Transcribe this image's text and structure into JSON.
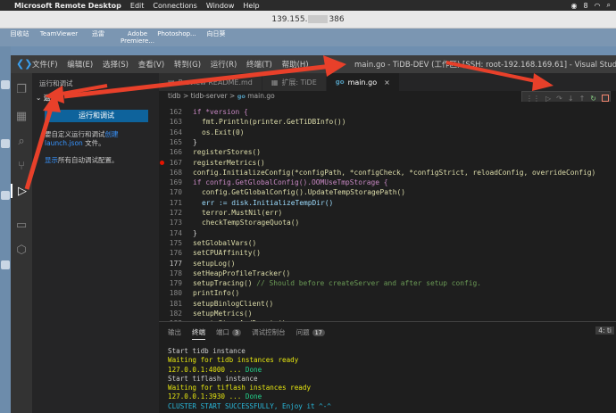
{
  "menubar": {
    "app": "Microsoft Remote Desktop",
    "items": [
      "Edit",
      "Connections",
      "Window",
      "Help"
    ],
    "right": [
      "8"
    ]
  },
  "rdp": {
    "title_left": "139.155.",
    "title_right": "386"
  },
  "desktop": {
    "icons": [
      "回收站",
      "TeamViewer",
      "迅雷",
      "Adobe Premiere...",
      "Photoshop...",
      "向日葵"
    ]
  },
  "window": {
    "menu": [
      "文件(F)",
      "编辑(E)",
      "选择(S)",
      "查看(V)",
      "转到(G)",
      "运行(R)",
      "终端(T)",
      "帮助(H)"
    ],
    "title": "main.go - TiDB-DEV (工作区) [SSH: root-192.168.169.61] - Visual Studio Code"
  },
  "sidebar": {
    "header": "运行和调试",
    "section": "运行",
    "run_button": "运行和调试",
    "p1_pre": "要自定义运行和调试",
    "p1_link": "创建 launch.json",
    "p1_post": " 文件。",
    "p2_link": "显示",
    "p2_post": "所有自动调试配置。"
  },
  "tabs": [
    {
      "label": "Preview README.md",
      "icon": ""
    },
    {
      "label": "扩展: TiDE",
      "icon": ""
    },
    {
      "label": "main.go",
      "icon": "go"
    }
  ],
  "breadcrumb": {
    "a": "tidb",
    "b": "tidb-server",
    "file": "main.go",
    "gi": "go",
    "sep": ">"
  },
  "code": [
    {
      "n": "162",
      "text": "if *version {",
      "cls": "kw",
      "indent": 0
    },
    {
      "n": "163",
      "text": "fmt.Println(printer.GetTiDBInfo())",
      "cls": "fn",
      "indent": 1
    },
    {
      "n": "164",
      "text": "os.Exit(0)",
      "cls": "fn",
      "indent": 1
    },
    {
      "n": "165",
      "text": "}",
      "cls": "plain",
      "indent": 0
    },
    {
      "n": "166",
      "text": "registerStores()",
      "cls": "fn",
      "indent": 0
    },
    {
      "n": "167",
      "text": "registerMetrics()",
      "cls": "fn",
      "indent": 0,
      "bp": true
    },
    {
      "n": "168",
      "text": "config.InitializeConfig(*configPath, *configCheck, *configStrict, reloadConfig, overrideConfig)",
      "cls": "fn",
      "indent": 0
    },
    {
      "n": "169",
      "text": "if config.GetGlobalConfig().OOMUseTmpStorage {",
      "cls": "kw",
      "indent": 0
    },
    {
      "n": "170",
      "text": "config.GetGlobalConfig().UpdateTempStoragePath()",
      "cls": "fn",
      "indent": 1
    },
    {
      "n": "171",
      "text": "err := disk.InitializeTempDir()",
      "cls": "id",
      "indent": 1
    },
    {
      "n": "172",
      "text": "terror.MustNil(err)",
      "cls": "fn",
      "indent": 1
    },
    {
      "n": "173",
      "text": "checkTempStorageQuota()",
      "cls": "fn",
      "indent": 1
    },
    {
      "n": "174",
      "text": "}",
      "cls": "plain",
      "indent": 0
    },
    {
      "n": "175",
      "text": "setGlobalVars()",
      "cls": "fn",
      "indent": 0
    },
    {
      "n": "176",
      "text": "setCPUAffinity()",
      "cls": "fn",
      "indent": 0
    },
    {
      "n": "177",
      "text": "setupLog()",
      "cls": "fn",
      "indent": 0,
      "cur": true
    },
    {
      "n": "178",
      "text": "setHeapProfileTracker()",
      "cls": "fn",
      "indent": 0
    },
    {
      "n": "179",
      "text": "setupTracing()",
      "cls": "fn",
      "indent": 0,
      "comment": " // Should before createServer and after setup config."
    },
    {
      "n": "180",
      "text": "printInfo()",
      "cls": "fn",
      "indent": 0
    },
    {
      "n": "181",
      "text": "setupBinlogClient()",
      "cls": "fn",
      "indent": 0
    },
    {
      "n": "182",
      "text": "setupMetrics()",
      "cls": "fn",
      "indent": 0
    },
    {
      "n": "183",
      "text": "createStoreAndDomain()",
      "cls": "fn",
      "indent": 0
    }
  ],
  "panel": {
    "tabs": [
      {
        "label": "输出"
      },
      {
        "label": "终端",
        "active": true
      },
      {
        "label": "端口",
        "badge": "3"
      },
      {
        "label": "调试控制台"
      },
      {
        "label": "问题",
        "badge": "17"
      }
    ],
    "terminal_select": "4: ti",
    "terminal": [
      {
        "text": "Start tidb instance",
        "c": "white"
      },
      {
        "text": "Waiting for tidb instances ready",
        "c": "yellow"
      },
      {
        "text": "127.0.0.1:4000 ... ",
        "c": "yellow",
        "tail": "Done",
        "tc": "green"
      },
      {
        "text": "Start tiflash instance",
        "c": "white"
      },
      {
        "text": "Waiting for tiflash instances ready",
        "c": "yellow"
      },
      {
        "text": "127.0.0.1:3930 ... ",
        "c": "yellow",
        "tail": "Done",
        "tc": "green"
      },
      {
        "text": "CLUSTER START SUCCESSFULLY, Enjoy it ^-^",
        "c": "cyan"
      }
    ]
  }
}
